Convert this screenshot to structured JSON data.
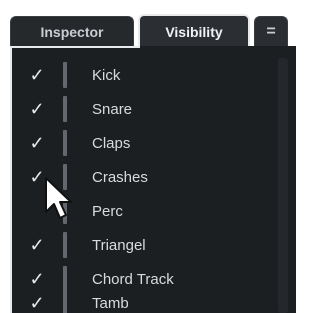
{
  "tabs": {
    "inspector": "Inspector",
    "visibility": "Visibility",
    "menu": "="
  },
  "tracks": [
    {
      "name": "Kick",
      "visible": true
    },
    {
      "name": "Snare",
      "visible": true
    },
    {
      "name": "Claps",
      "visible": true
    },
    {
      "name": "Crashes",
      "visible": true
    },
    {
      "name": "Perc",
      "visible": false
    },
    {
      "name": "Triangel",
      "visible": true
    },
    {
      "name": "Chord Track",
      "visible": true
    },
    {
      "name": "Tamb",
      "visible": true
    }
  ],
  "checkmark": "✓",
  "colors": {
    "panel_bg": "#1c1f22",
    "tab_bg": "#2b2f33",
    "active_tab_border": "#e8eaec",
    "track_bar": "#62686e"
  }
}
